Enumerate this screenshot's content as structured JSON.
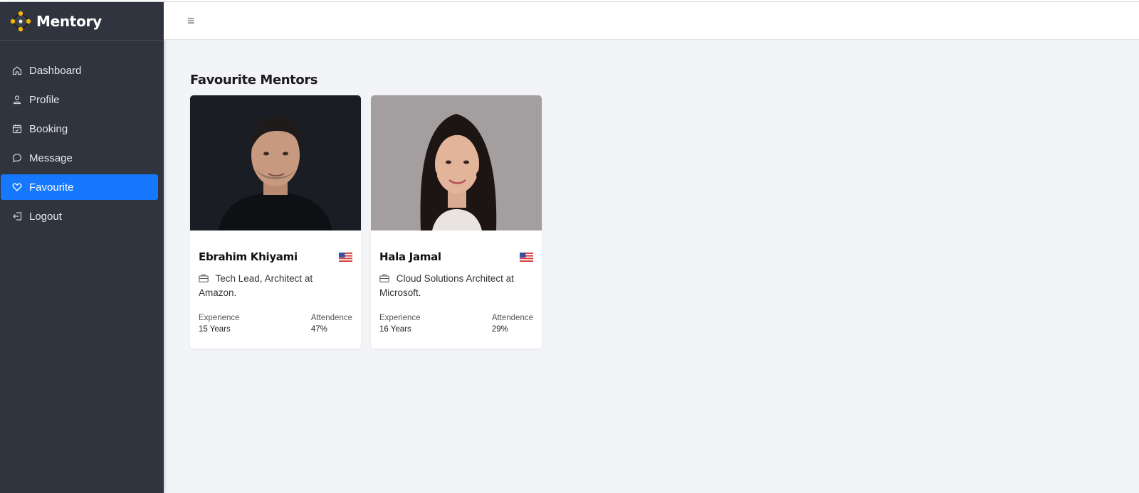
{
  "brand": {
    "name": "Mentory"
  },
  "sidebar": {
    "items": [
      {
        "label": "Dashboard",
        "icon": "home-icon",
        "active": false
      },
      {
        "label": "Profile",
        "icon": "user-icon",
        "active": false
      },
      {
        "label": "Booking",
        "icon": "calendar-icon",
        "active": false
      },
      {
        "label": "Message",
        "icon": "chat-icon",
        "active": false
      },
      {
        "label": "Favourite",
        "icon": "heart-icon",
        "active": true
      },
      {
        "label": "Logout",
        "icon": "logout-icon",
        "active": false
      }
    ]
  },
  "topbar": {
    "menu_icon": "hamburger-icon",
    "menu_glyph": "≡"
  },
  "main": {
    "title": "Favourite Mentors",
    "mentors": [
      {
        "name": "Ebrahim Khiyami",
        "role": "Tech Lead, Architect at Amazon.",
        "country_flag": "us-flag-icon",
        "experience_label": "Experience",
        "experience_value": "15 Years",
        "attendance_label": "Attendence",
        "attendance_value": "47%"
      },
      {
        "name": "Hala Jamal",
        "role": "Cloud Solutions Architect at Microsoft.",
        "country_flag": "us-flag-icon",
        "experience_label": "Experience",
        "experience_value": "16 Years",
        "attendance_label": "Attendence",
        "attendance_value": "29%"
      }
    ]
  },
  "colors": {
    "sidebar_bg": "#2f343e",
    "accent": "#1677ff",
    "page_bg": "#f3f4f8"
  }
}
